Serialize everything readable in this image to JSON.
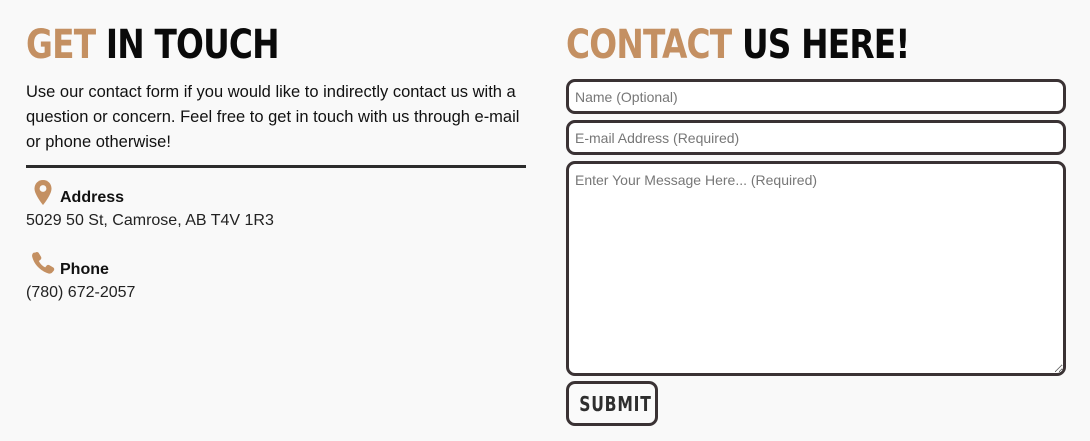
{
  "left": {
    "heading_accent": "GET",
    "heading_rest": "IN TOUCH",
    "intro": "Use our contact form if you would like to indirectly contact us with a question or concern. Feel free to get in touch with us through e-mail or phone otherwise!",
    "address": {
      "icon": "map-pin-icon",
      "title": "Address",
      "value": "5029 50 St, Camrose, AB T4V 1R3"
    },
    "phone": {
      "icon": "phone-icon",
      "title": "Phone",
      "value": "(780) 672-2057"
    }
  },
  "right": {
    "heading_accent": "CONTACT",
    "heading_rest": "US HERE!",
    "name_placeholder": "Name (Optional)",
    "email_placeholder": "E-mail Address (Required)",
    "message_placeholder": "Enter Your Message Here... (Required)",
    "submit_label": "SUBMIT"
  },
  "colors": {
    "accent": "#c49062",
    "border": "#3a3234",
    "background": "#f9f9f9"
  }
}
